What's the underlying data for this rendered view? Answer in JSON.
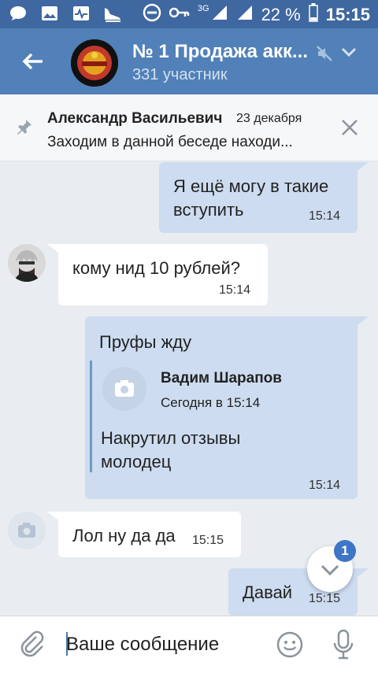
{
  "status_bar": {
    "signal_label": "3G",
    "battery_percent": "22 %",
    "time": "15:15",
    "battery_level": 0.22
  },
  "header": {
    "title": "№ 1 Продажа акк...",
    "subtitle": "331 участник"
  },
  "pinned": {
    "author": "Александр Васильевич",
    "date": "23 декабря",
    "text": "Заходим в данной беседе находи..."
  },
  "messages": [
    {
      "text_line1": "Я ещё могу в такие",
      "text_line2": "вступить",
      "time": "15:14"
    },
    {
      "text": "кому нид 10 рублей?",
      "time": "15:14"
    },
    {
      "text": "Пруфы жду",
      "reply_author": "Вадим Шарапов",
      "reply_time": "Сегодня в 15:14",
      "reply_line1": "Накрутил отзывы",
      "reply_line2": "молодец",
      "time": "15:14"
    },
    {
      "text": "Лол ну да да",
      "time": "15:15"
    },
    {
      "text": "Давай",
      "time": "15:15"
    }
  ],
  "scroll_down": {
    "badge": "1"
  },
  "composer": {
    "placeholder": "Ваше сообщение"
  },
  "colors": {
    "status_bar": "#3f67a0",
    "header": "#5181b8",
    "background": "#e9edf1",
    "bubble_out": "#cddcf0",
    "bubble_in": "#ffffff",
    "accent": "#3e76c7"
  },
  "icons": [
    "chat-icon",
    "gallery-icon",
    "activity-icon",
    "shoe-icon",
    "no-disturb-icon",
    "key-icon",
    "signal-icon",
    "battery-icon",
    "back-arrow-icon",
    "mute-icon",
    "chevron-down-icon",
    "pin-icon",
    "close-icon",
    "camera-icon",
    "attach-icon",
    "emoji-icon",
    "mic-icon"
  ]
}
